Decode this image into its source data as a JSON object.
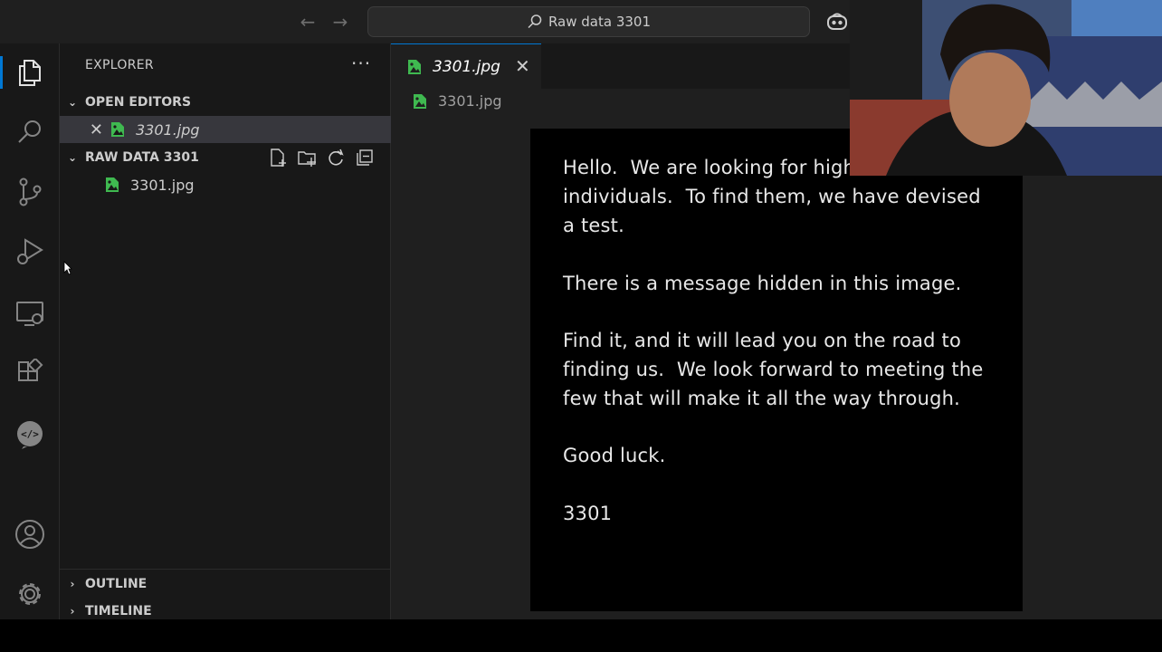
{
  "titlebar": {
    "command_center_text": "Raw data 3301",
    "back_icon": "arrow-left-icon",
    "forward_icon": "arrow-right-icon",
    "search_icon": "search-icon",
    "copilot_icon": "copilot-icon"
  },
  "activity_bar": {
    "items": [
      "explorer-icon",
      "search-icon",
      "source-control-icon",
      "run-debug-icon",
      "remote-explorer-icon",
      "extensions-icon",
      "live-share-icon"
    ],
    "bottom_items": [
      "accounts-icon",
      "settings-gear-icon"
    ]
  },
  "sidebar": {
    "title": "EXPLORER",
    "more": "···",
    "open_editors": {
      "label": "OPEN EDITORS",
      "files": [
        {
          "name": "3301.jpg"
        }
      ]
    },
    "workspace": {
      "label": "RAW DATA 3301",
      "files": [
        {
          "name": "3301.jpg"
        }
      ]
    },
    "outline_label": "OUTLINE",
    "timeline_label": "TIMELINE"
  },
  "editor": {
    "tab_label": "3301.jpg",
    "breadcrumb": "3301.jpg",
    "image_lines": [
      "Hello.  We are looking for high",
      "individuals.  To find them, we have devised",
      "a test.",
      "There is a message hidden in this image.",
      "Find it, and it will lead you on the road to",
      "finding us.  We look forward to meeting the",
      "few that will make it all the way through.",
      "Good luck.",
      "3301"
    ]
  },
  "colors": {
    "accent": "#0078d4",
    "sidebar_bg": "#181818",
    "editor_bg": "#1f1f1f",
    "image_icon": "#3fb950"
  }
}
